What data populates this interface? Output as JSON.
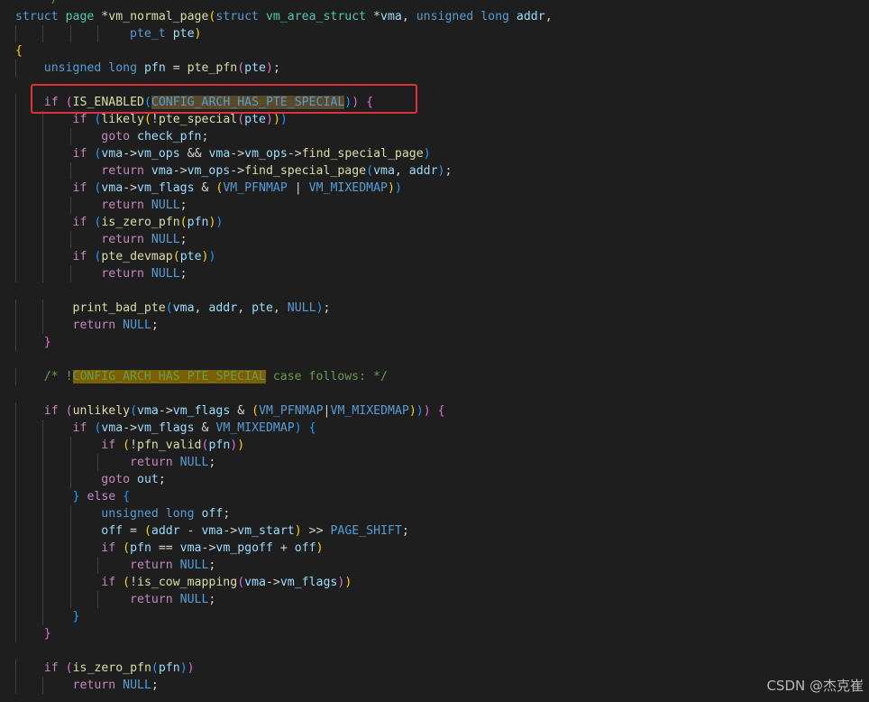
{
  "editor": {
    "language": "c",
    "theme": "dark",
    "colors": {
      "background": "#1e1e1e",
      "keyword": "#569cd6",
      "control": "#c586c0",
      "function": "#dcdcaa",
      "variable": "#9cdcfe",
      "comment": "#6a9955",
      "highlight_box": "#e0303a"
    }
  },
  "code_lines": [
    "    */",
    "struct page *vm_normal_page(struct vm_area_struct *vma, unsigned long addr,",
    "                pte_t pte)",
    "{",
    "    unsigned long pfn = pte_pfn(pte);",
    "",
    "    if (IS_ENABLED(CONFIG_ARCH_HAS_PTE_SPECIAL)) {",
    "        if (likely(!pte_special(pte)))",
    "            goto check_pfn;",
    "        if (vma->vm_ops && vma->vm_ops->find_special_page)",
    "            return vma->vm_ops->find_special_page(vma, addr);",
    "        if (vma->vm_flags & (VM_PFNMAP | VM_MIXEDMAP))",
    "            return NULL;",
    "        if (is_zero_pfn(pfn))",
    "            return NULL;",
    "        if (pte_devmap(pte))",
    "            return NULL;",
    "",
    "        print_bad_pte(vma, addr, pte, NULL);",
    "        return NULL;",
    "    }",
    "",
    "    /* !CONFIG_ARCH_HAS_PTE_SPECIAL case follows: */",
    "",
    "    if (unlikely(vma->vm_flags & (VM_PFNMAP|VM_MIXEDMAP))) {",
    "        if (vma->vm_flags & VM_MIXEDMAP) {",
    "            if (!pfn_valid(pfn))",
    "                return NULL;",
    "            goto out;",
    "        } else {",
    "            unsigned long off;",
    "            off = (addr - vma->vm_start) >> PAGE_SHIFT;",
    "            if (pfn == vma->vm_pgoff + off)",
    "                return NULL;",
    "            if (!is_cow_mapping(vma->vm_flags))",
    "                return NULL;",
    "        }",
    "    }",
    "",
    "    if (is_zero_pfn(pfn))",
    "        return NULL;"
  ],
  "highlighted_token": "CONFIG_ARCH_HAS_PTE_SPECIAL",
  "watermark": "CSDN @杰克崔"
}
